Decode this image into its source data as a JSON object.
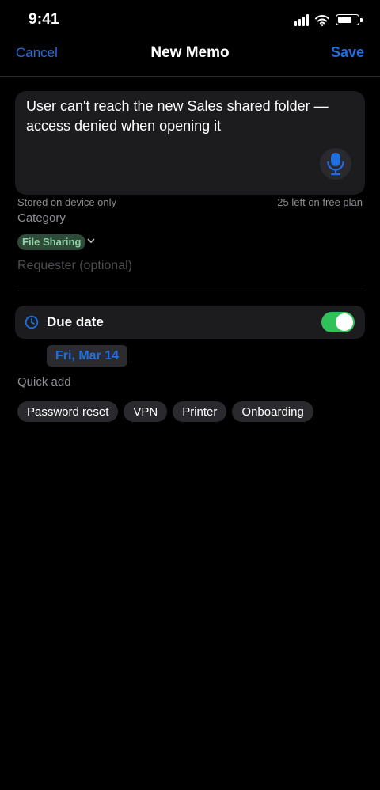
{
  "status_bar": {
    "time": "9:41"
  },
  "nav": {
    "cancel_label": "Cancel",
    "title": "New Memo",
    "save_label": "Save"
  },
  "memo": {
    "text": "User can't reach the new Sales shared folder — access denied when opening it",
    "storage_note": "Stored on device only",
    "remaining_note": "25 left on free plan"
  },
  "category": {
    "label": "Category",
    "selected": "File Sharing"
  },
  "requester": {
    "placeholder": "Requester (optional)",
    "value": ""
  },
  "due_date": {
    "label": "Due date",
    "enabled": true,
    "value": "Fri, Mar 14"
  },
  "quick_add": {
    "label": "Quick add",
    "items": [
      "Password reset",
      "VPN",
      "Printer",
      "Onboarding"
    ]
  },
  "icons": {
    "mic": "microphone-icon",
    "clock": "clock-icon",
    "chevron": "chevron-down-icon",
    "signal": "cellular-signal-icon",
    "wifi": "wifi-icon",
    "battery": "battery-icon"
  },
  "colors": {
    "accent": "#1f6fe0",
    "toggle_on": "#30c158",
    "chip_bg": "#2f4a38",
    "chip_text": "#8fd4a6",
    "background": "#000000",
    "card": "#1c1c1e"
  }
}
